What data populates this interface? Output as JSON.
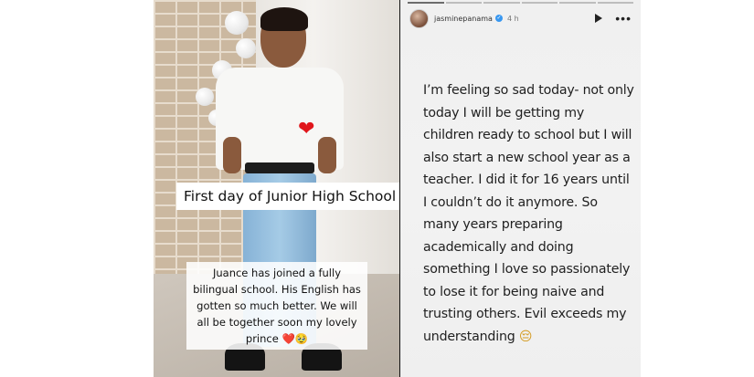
{
  "left_story": {
    "caption_title": "First day of Junior High School",
    "caption_body_text": "Juance has joined a fully bilingual school. His English has gotten so much better. We will all be together soon my lovely prince ❤️🥹",
    "heart_sticker": "❤"
  },
  "right_story": {
    "progress": {
      "segments": 6,
      "active_index": 0
    },
    "header": {
      "username": "jasminepanama",
      "verified_badge": "✓",
      "timestamp": "4 h",
      "play_icon": "play-icon",
      "more_icon": "•••"
    },
    "body": {
      "text": "I’m feeling so sad today- not only today I will be getting my children ready to school but I will also start a new school year as a teacher. I did it for 16 years until I couldn’t do it anymore. So many years preparing academically and doing something I love so passionately to lose it for being naive and trusting others. Evil exceeds my understanding",
      "emoji": "😔"
    }
  }
}
